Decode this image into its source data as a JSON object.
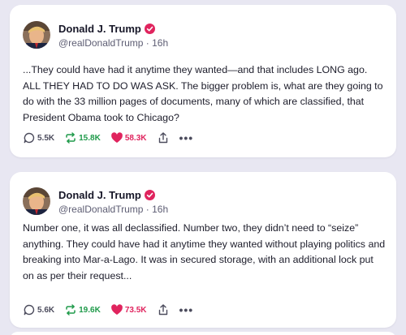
{
  "colors": {
    "page_background": "#e8e7f2",
    "verified_badge": "#e0245e",
    "retruth_green": "#1f9a4a",
    "like_red": "#e0245e"
  },
  "posts": [
    {
      "author": {
        "display_name": "Donald J. Trump",
        "handle": "@realDonaldTrump · 16h",
        "verified_icon": "verified-badge-icon",
        "avatar": "profile-photo"
      },
      "text": "...They could have had it anytime they wanted—and that includes LONG ago. ALL THEY HAD TO DO WAS ASK. The bigger problem is, what are they going to do with the 33 million pages of documents, many of which are classified, that President Obama took to Chicago?",
      "stats": {
        "replies": "5.5K",
        "retruths": "15.8K",
        "likes": "58.3K"
      }
    },
    {
      "author": {
        "display_name": "Donald J. Trump",
        "handle": "@realDonaldTrump · 16h",
        "verified_icon": "verified-badge-icon",
        "avatar": "profile-photo"
      },
      "text": "Number one, it was all declassified. Number two, they didn’t need to “seize” anything. They could have had it anytime they wanted without playing politics and breaking into Mar-a-Lago. It was in secured storage, with an additional lock put on as per their request...",
      "stats": {
        "replies": "5.6K",
        "retruths": "19.6K",
        "likes": "73.5K"
      }
    }
  ],
  "action_icons": [
    "reply-icon",
    "retruth-icon",
    "heart-icon",
    "share-icon",
    "more-icon"
  ],
  "more_glyph": "•••"
}
